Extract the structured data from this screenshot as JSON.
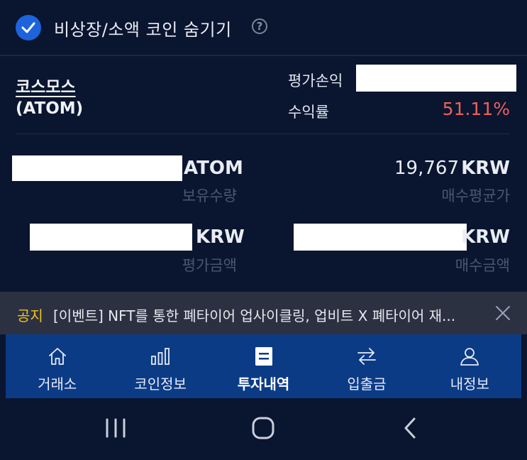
{
  "filter": {
    "label": "비상장/소액 코인 숨기기",
    "help": "?"
  },
  "coin": {
    "name": "코스모스",
    "ticker": "(ATOM)",
    "profit_loss_label": "평가손익",
    "return_rate_label": "수익률",
    "return_rate_value": "51.11%"
  },
  "stats": {
    "holding_unit": "ATOM",
    "holding_label": "보유수량",
    "avg_price_value": "19,767",
    "avg_price_unit": "KRW",
    "avg_price_label": "매수평균가",
    "eval_amount_unit": "KRW",
    "eval_amount_label": "평가금액",
    "buy_amount_unit": "KRW",
    "buy_amount_label": "매수금액"
  },
  "notice": {
    "tag": "공지",
    "text": "[이벤트] NFT를 통한 폐타이어 업사이클링, 업비트 X 폐타이어 재..."
  },
  "tabs": [
    {
      "label": "거래소",
      "icon": "home-icon"
    },
    {
      "label": "코인정보",
      "icon": "bar-chart-icon"
    },
    {
      "label": "투자내역",
      "icon": "document-icon"
    },
    {
      "label": "입출금",
      "icon": "transfer-icon"
    },
    {
      "label": "내정보",
      "icon": "user-icon"
    }
  ],
  "colors": {
    "background": "#0a1530",
    "accent": "#1d64dc",
    "tabbar": "#0c3b86",
    "profit": "#f0605a",
    "notice_tag": "#f0c419"
  }
}
